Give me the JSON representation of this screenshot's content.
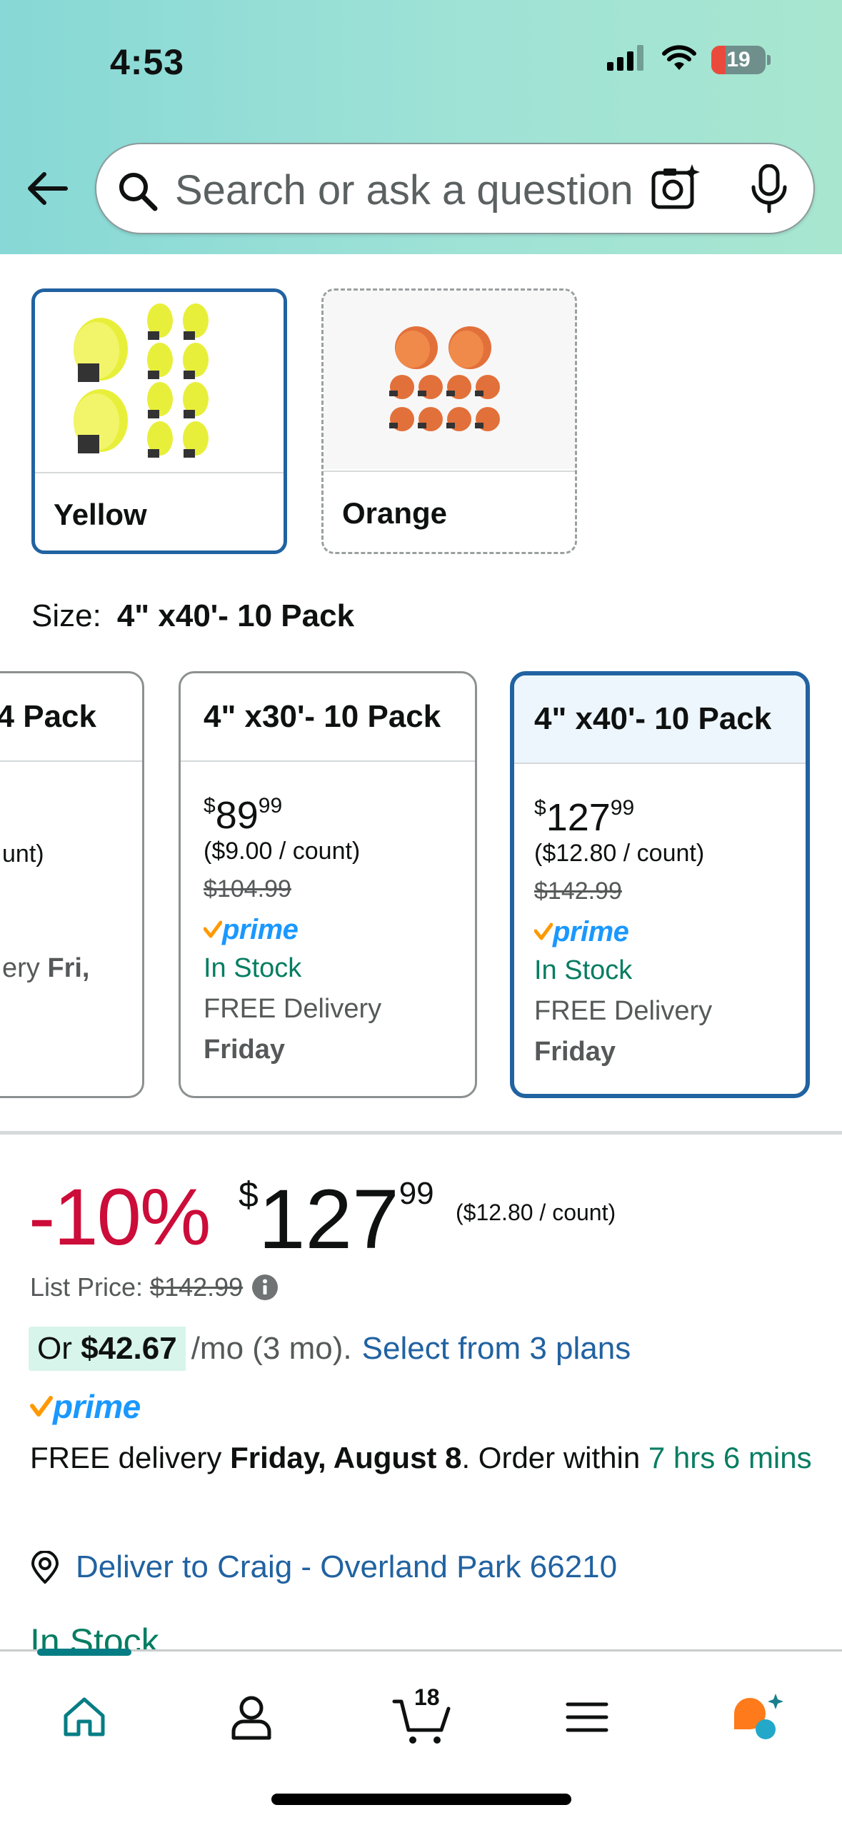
{
  "status_bar": {
    "time": "4:53",
    "battery": "19"
  },
  "search": {
    "placeholder": "Search or ask a question"
  },
  "colors": {
    "options": [
      {
        "label": "Yellow",
        "selected": true
      },
      {
        "label": "Orange",
        "selected": false
      }
    ]
  },
  "size": {
    "label": "Size:",
    "value": "4\" x40'- 10 Pack"
  },
  "size_cards": {
    "partial": {
      "title": "4 Pack",
      "unit": "unt)",
      "delivery": "ery",
      "day": "Fri,"
    },
    "card_30": {
      "title": "4\" x30'- 10 Pack",
      "price_symbol": "$",
      "price_whole": "89",
      "price_cents": "99",
      "unit_price": "($9.00 / count)",
      "list_price": "$104.99",
      "prime": "prime",
      "stock": "In Stock",
      "delivery": "FREE Delivery",
      "day": "Friday"
    },
    "card_40": {
      "title": "4\" x40'- 10 Pack",
      "price_symbol": "$",
      "price_whole": "127",
      "price_cents": "99",
      "unit_price": "($12.80 / count)",
      "list_price": "$142.99",
      "prime": "prime",
      "stock": "In Stock",
      "delivery": "FREE Delivery",
      "day": "Friday",
      "selected": true
    }
  },
  "price": {
    "discount": "-10%",
    "symbol": "$",
    "whole": "127",
    "cents": "99",
    "per_count": "($12.80 / count)",
    "list_label": "List Price:",
    "list_value": "$142.99"
  },
  "installment": {
    "prefix": "Or",
    "amount": "$42.67",
    "per_month": "/mo (3 mo).",
    "plans_link": "Select from 3 plans"
  },
  "prime_badge": "prime",
  "delivery": {
    "prefix": "FREE delivery",
    "date": "Friday, August 8",
    "order_within": ". Order within",
    "countdown": "7 hrs 6 mins"
  },
  "deliver_to": "Deliver to Craig - Overland Park 66210",
  "stock_peek": "In Stock",
  "tabbar": {
    "cart_count": "18",
    "active_tab": "home",
    "accent": "#067d84"
  },
  "palette": {
    "selected_border": "#2162a1",
    "discount_red": "#cc0c39",
    "stock_green": "#067d62",
    "link_blue": "#2162a1",
    "prime_blue": "#1a98ff"
  }
}
